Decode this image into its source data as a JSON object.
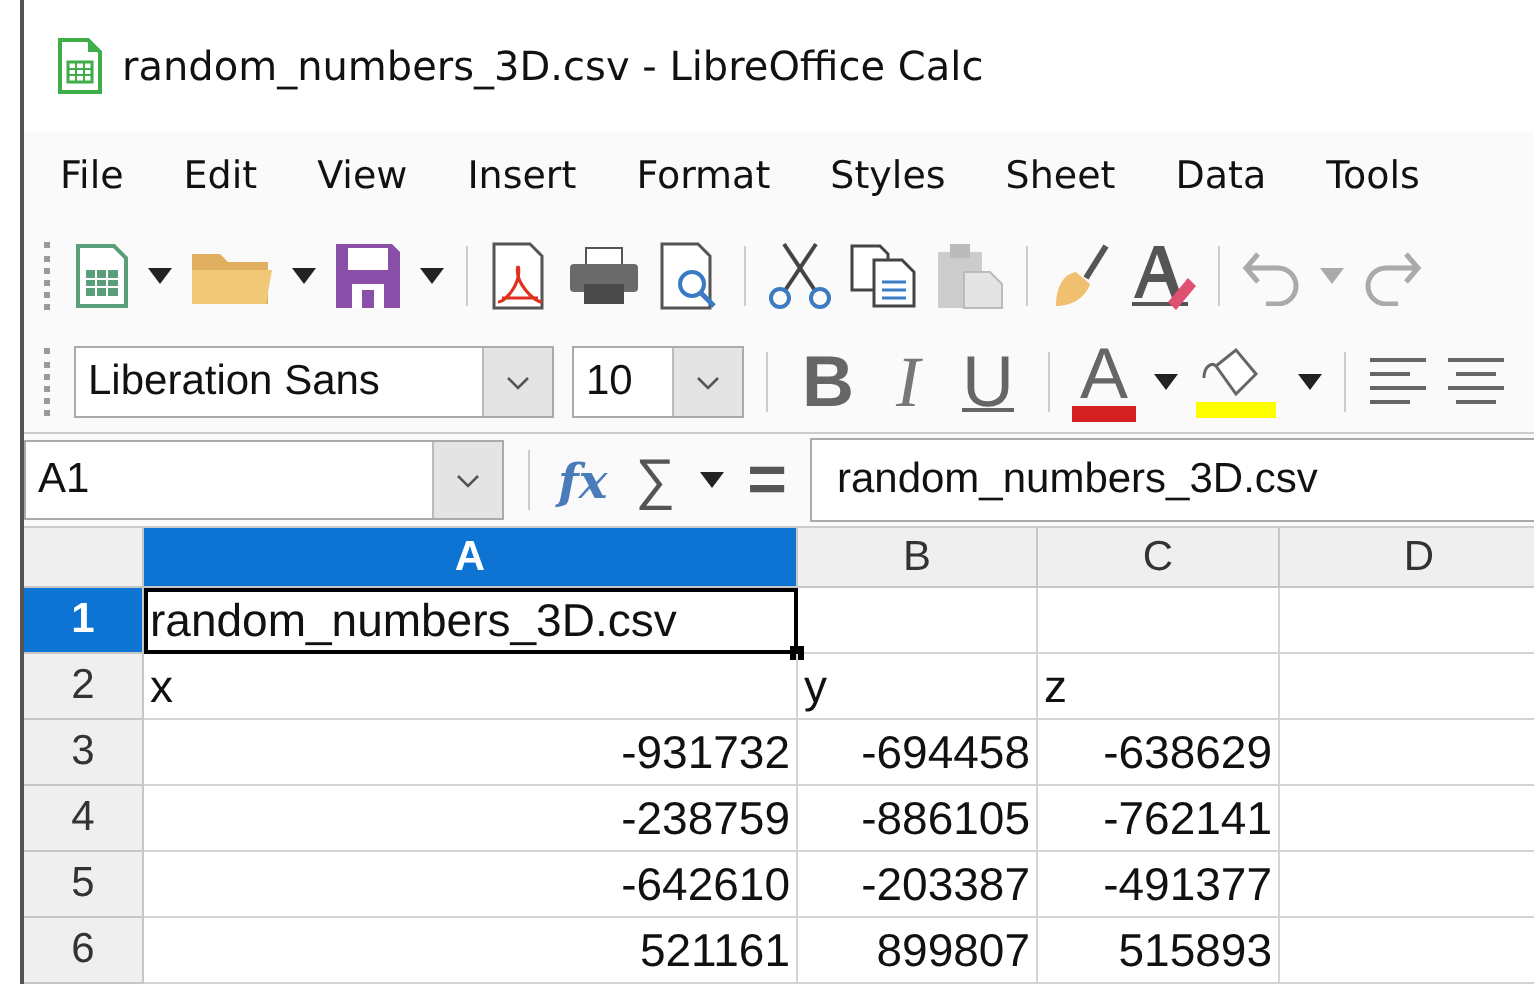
{
  "window": {
    "title": "random_numbers_3D.csv - LibreOffice Calc"
  },
  "menu": [
    "File",
    "Edit",
    "View",
    "Insert",
    "Format",
    "Styles",
    "Sheet",
    "Data",
    "Tools"
  ],
  "formatting": {
    "font_name": "Liberation Sans",
    "font_size": "10",
    "bold": "B",
    "italic": "I",
    "underline": "U",
    "font_color": "A"
  },
  "formula_bar": {
    "cell_ref": "A1",
    "function_wizard": "fx",
    "sum": "∑",
    "equals": "=",
    "content": "random_numbers_3D.csv"
  },
  "sheet": {
    "columns": [
      {
        "label": "A",
        "selected": true
      },
      {
        "label": "B",
        "selected": false
      },
      {
        "label": "C",
        "selected": false
      },
      {
        "label": "D",
        "selected": false
      }
    ],
    "rows": [
      {
        "label": "1",
        "selected": true,
        "cells": [
          {
            "kind": "text",
            "value": "random_numbers_3D.csv",
            "selected": true
          }
        ]
      },
      {
        "label": "2",
        "selected": false,
        "cells": [
          {
            "kind": "text",
            "value": "x",
            "selected": false
          },
          {
            "kind": "text",
            "value": "y",
            "selected": false
          },
          {
            "kind": "text",
            "value": "z",
            "selected": false
          }
        ]
      },
      {
        "label": "3",
        "selected": false,
        "cells": [
          {
            "kind": "number",
            "value": "-931732",
            "selected": false
          },
          {
            "kind": "number",
            "value": "-694458",
            "selected": false
          },
          {
            "kind": "number",
            "value": "-638629",
            "selected": false
          }
        ]
      },
      {
        "label": "4",
        "selected": false,
        "cells": [
          {
            "kind": "number",
            "value": "-238759",
            "selected": false
          },
          {
            "kind": "number",
            "value": "-886105",
            "selected": false
          },
          {
            "kind": "number",
            "value": "-762141",
            "selected": false
          }
        ]
      },
      {
        "label": "5",
        "selected": false,
        "cells": [
          {
            "kind": "number",
            "value": "-642610",
            "selected": false
          },
          {
            "kind": "number",
            "value": "-203387",
            "selected": false
          },
          {
            "kind": "number",
            "value": "-491377",
            "selected": false
          }
        ]
      },
      {
        "label": "6",
        "selected": false,
        "cells": [
          {
            "kind": "number",
            "value": "521161",
            "selected": false
          },
          {
            "kind": "number",
            "value": "899807",
            "selected": false
          },
          {
            "kind": "number",
            "value": "515893",
            "selected": false
          }
        ]
      }
    ]
  }
}
